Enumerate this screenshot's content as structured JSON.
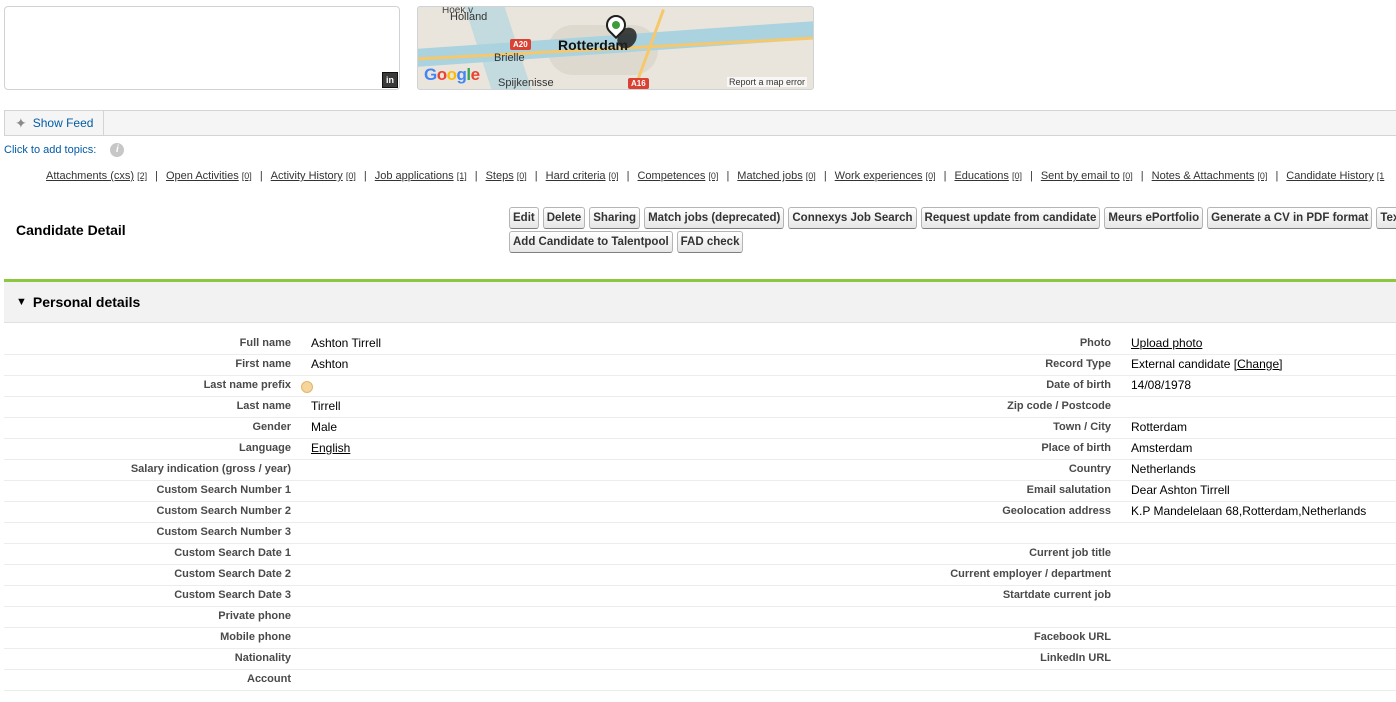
{
  "map": {
    "labels": {
      "holland": "Holland",
      "rotterdam": "Rotterdam",
      "brielle": "Brielle",
      "spijkenisse": "Spijkenisse",
      "a20": "A20",
      "a16": "A16",
      "hoek": "Hoek v"
    },
    "google": "Google",
    "report": "Report a map error"
  },
  "feed": {
    "show_label": "Show Feed"
  },
  "topics": {
    "label": "Click to add topics:"
  },
  "related_lists": [
    {
      "label": "Attachments (cxs)",
      "count": "[2]"
    },
    {
      "label": "Open Activities",
      "count": "[0]"
    },
    {
      "label": "Activity History",
      "count": "[0]"
    },
    {
      "label": "Job applications",
      "count": "[1]"
    },
    {
      "label": "Steps",
      "count": "[0]"
    },
    {
      "label": "Hard criteria",
      "count": "[0]"
    },
    {
      "label": "Competences",
      "count": "[0]"
    },
    {
      "label": "Matched jobs",
      "count": "[0]"
    },
    {
      "label": "Work experiences",
      "count": "[0]"
    },
    {
      "label": "Educations",
      "count": "[0]"
    },
    {
      "label": "Sent by email to",
      "count": "[0]"
    },
    {
      "label": "Notes & Attachments",
      "count": "[0]"
    },
    {
      "label": "Candidate History",
      "count": "[1"
    }
  ],
  "detail": {
    "title": "Candidate Detail",
    "buttons_row1": [
      "Edit",
      "Delete",
      "Sharing",
      "Match jobs (deprecated)",
      "Connexys Job Search",
      "Request update from candidate",
      "Meurs ePortfolio",
      "Generate a CV in PDF format",
      "Textke"
    ],
    "buttons_row2": [
      "Add Candidate to Talentpool",
      "FAD check"
    ]
  },
  "section": {
    "title": "Personal details",
    "rows": [
      {
        "ll": "Full name",
        "lv": "Ashton Tirrell",
        "rl": "Photo",
        "rv": "Upload photo"
      },
      {
        "ll": "First name",
        "lv": "Ashton",
        "rl": "Record Type",
        "rv": "External candidate",
        "rv_link": "[Change]"
      },
      {
        "ll": "Last name prefix",
        "lv": "",
        "rl": "Date of birth",
        "rv": "14/08/1978"
      },
      {
        "ll": "Last name",
        "lv": "Tirrell",
        "rl": "Zip code / Postcode",
        "rv": ""
      },
      {
        "ll": "Gender",
        "lv": "Male",
        "rl": "Town / City",
        "rv": "Rotterdam"
      },
      {
        "ll": "Language",
        "lv": "English",
        "rl": "Place of birth",
        "rv": "Amsterdam"
      },
      {
        "ll": "Salary indication (gross / year)",
        "lv": "",
        "rl": "Country",
        "rv": "Netherlands"
      },
      {
        "ll": "Custom Search Number 1",
        "lv": "",
        "rl": "Email salutation",
        "rv": "Dear Ashton Tirrell"
      },
      {
        "ll": "Custom Search Number 2",
        "lv": "",
        "rl": "Geolocation address",
        "rv": "K.P Mandelelaan 68,Rotterdam,Netherlands"
      },
      {
        "ll": "Custom Search Number 3",
        "lv": "",
        "rl": "",
        "rv": ""
      },
      {
        "ll": "Custom Search Date 1",
        "lv": "",
        "rl": "Current job title",
        "rv": ""
      },
      {
        "ll": "Custom Search Date 2",
        "lv": "",
        "rl": "Current employer / department",
        "rv": ""
      },
      {
        "ll": "Custom Search Date 3",
        "lv": "",
        "rl": "Startdate current job",
        "rv": ""
      },
      {
        "ll": "Private phone",
        "lv": "",
        "rl": "",
        "rv": ""
      },
      {
        "ll": "Mobile phone",
        "lv": "",
        "rl": "Facebook URL",
        "rv": ""
      },
      {
        "ll": "Nationality",
        "lv": "",
        "rl": "LinkedIn URL",
        "rv": ""
      },
      {
        "ll": "Account",
        "lv": "",
        "rl": "",
        "rv": ""
      }
    ]
  },
  "colors": {
    "accent": "#8dc63f",
    "link": "#015ba7"
  }
}
